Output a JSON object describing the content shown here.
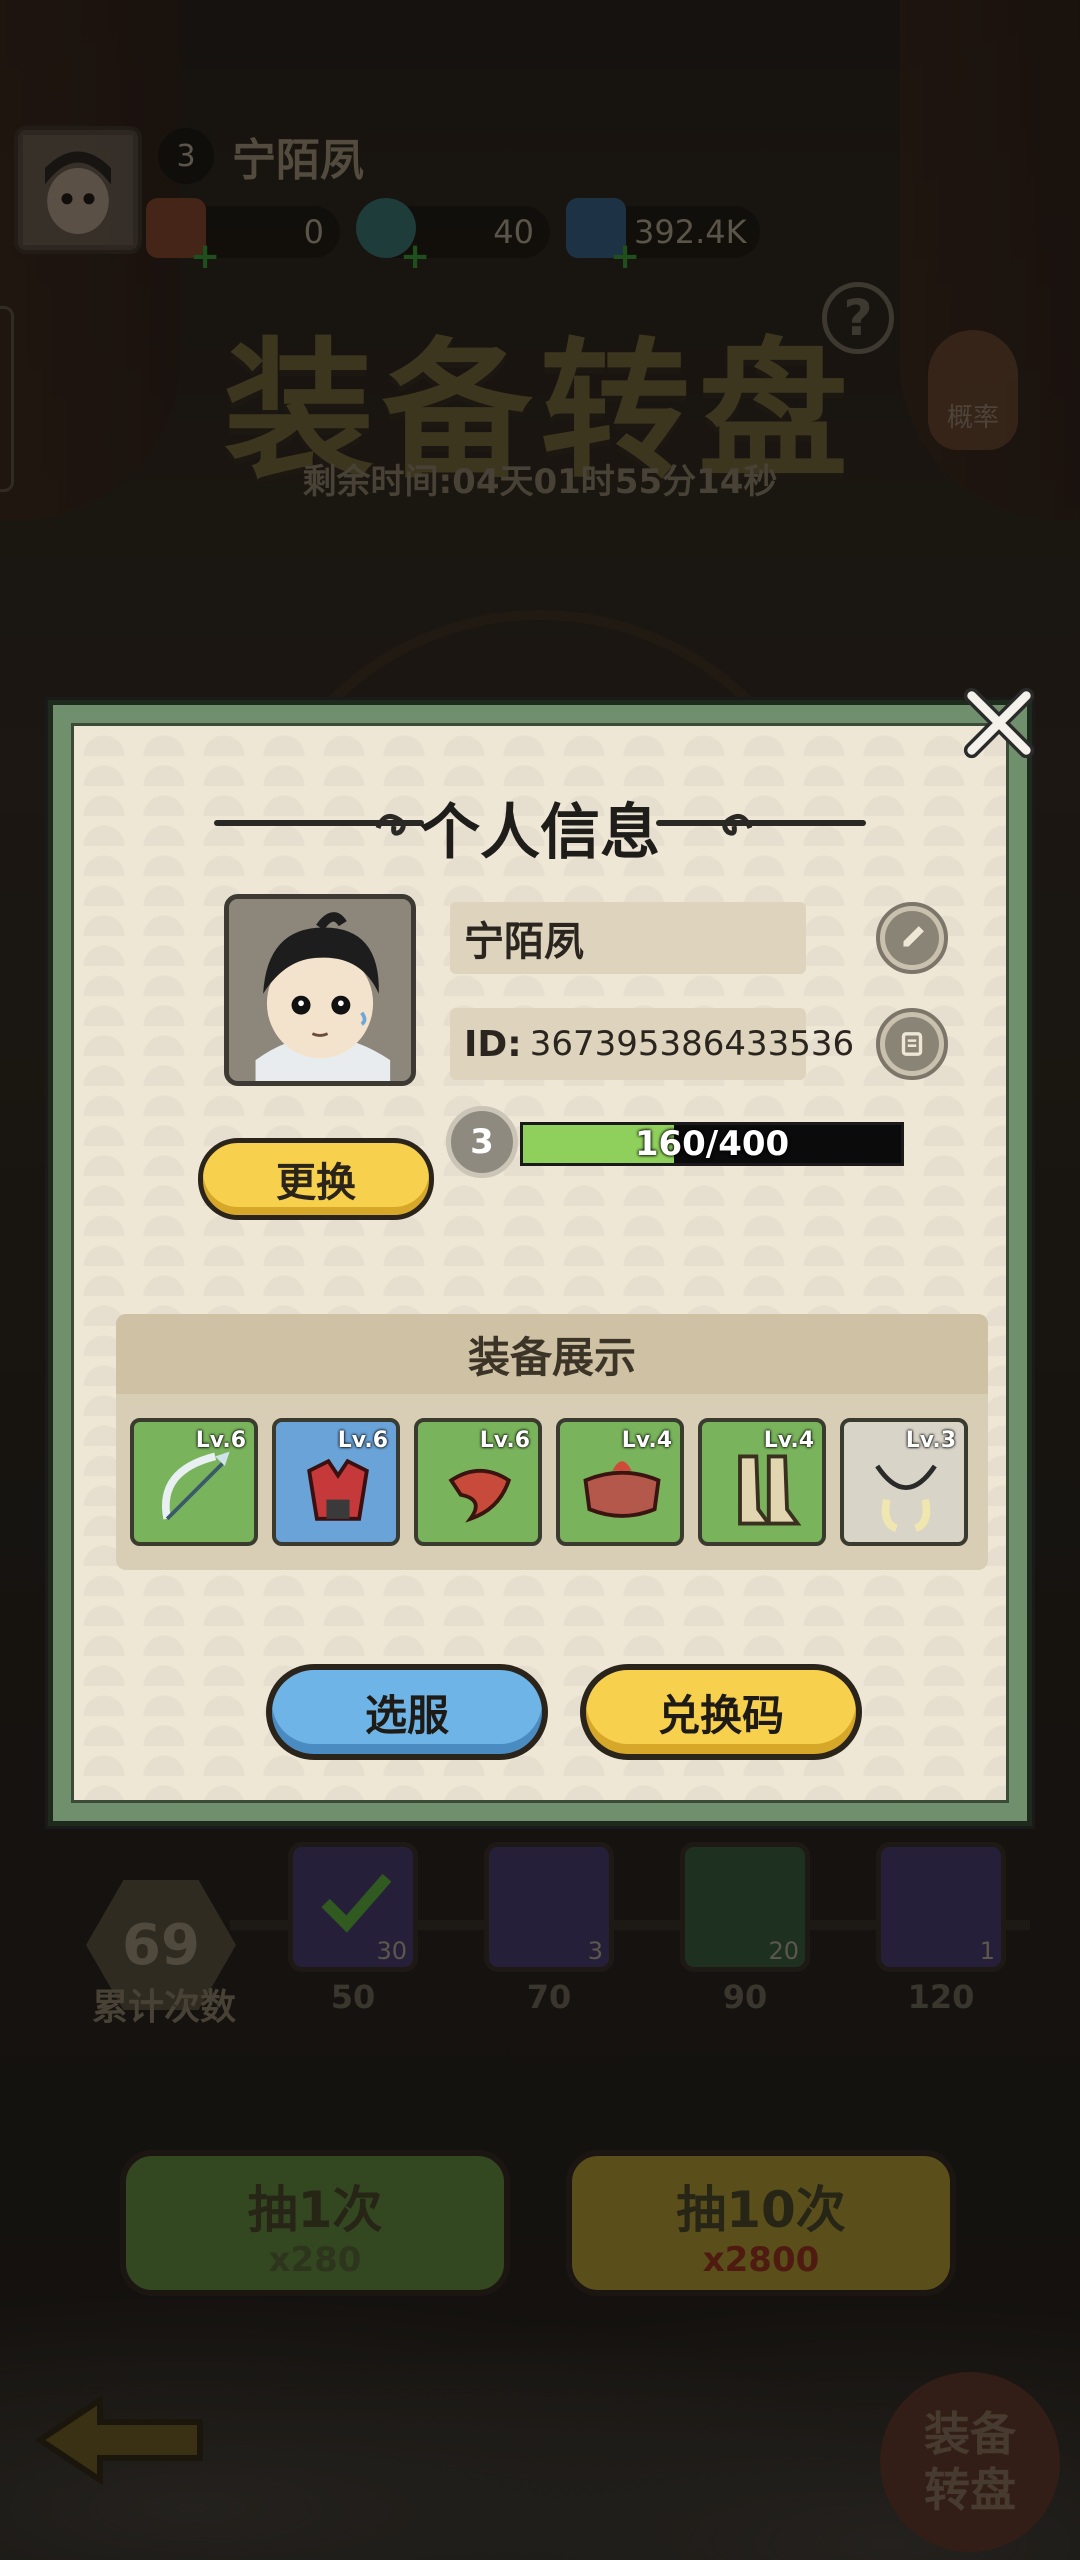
{
  "background": {
    "player": {
      "name": "宁陌夙",
      "level": "3"
    },
    "resources": [
      {
        "icon": "scroll-icon",
        "value": "0"
      },
      {
        "icon": "jade-icon",
        "value": "40"
      },
      {
        "icon": "crystal-icon",
        "value": "392.4K"
      }
    ],
    "title": "装备转盘",
    "timer": "剩余时间:04天01时55分14秒",
    "rate_label": "概率",
    "help_label": "?",
    "count": {
      "value": "69",
      "label": "累计次数"
    },
    "rewards": [
      {
        "qty": "30",
        "milestone": "50"
      },
      {
        "qty": "3",
        "milestone": "70"
      },
      {
        "qty": "20",
        "milestone": "90"
      },
      {
        "qty": "1",
        "milestone": "120"
      }
    ],
    "draw_one": {
      "label": "抽1次",
      "cost": "x280"
    },
    "draw_ten": {
      "label": "抽10次",
      "cost": "x2800"
    },
    "wheel_button": "装备\n转盘"
  },
  "modal": {
    "title": "个人信息",
    "name": "宁陌夙",
    "id_label": "ID:",
    "id_value": "367395386433536",
    "level": "3",
    "xp_text": "160/400",
    "xp_fraction": 0.4,
    "change_label": "更换",
    "equipment_title": "装备展示",
    "equipment": [
      {
        "level": "Lv.6",
        "icon": "bow-icon",
        "bg": "#79b35b"
      },
      {
        "level": "Lv.6",
        "icon": "armor-icon",
        "bg": "#6aa3d8"
      },
      {
        "level": "Lv.6",
        "icon": "scarf-icon",
        "bg": "#79b35b"
      },
      {
        "level": "Lv.4",
        "icon": "belt-icon",
        "bg": "#79b35b"
      },
      {
        "level": "Lv.4",
        "icon": "boots-icon",
        "bg": "#79b35b"
      },
      {
        "level": "Lv.3",
        "icon": "necklace-icon",
        "bg": "#d9d4c8"
      }
    ],
    "server_button": "选服",
    "code_button": "兑换码"
  },
  "colors": {
    "accent_yellow": "#f7d04e",
    "accent_blue": "#6fb4e6",
    "frame_green": "#6f8f6d",
    "xp_green": "#8fd05c"
  }
}
